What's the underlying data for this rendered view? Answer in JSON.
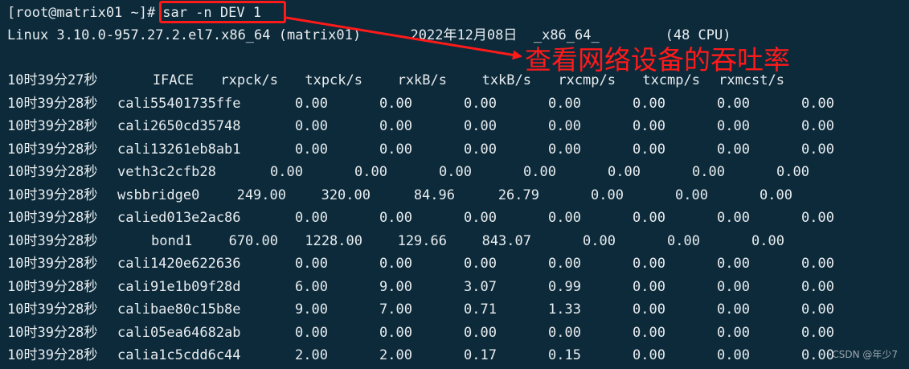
{
  "terminal": {
    "prompt": "[root@matrix01 ~]#",
    "command": "sar -n DEV 1",
    "sysinfo": "Linux 3.10.0-957.27.2.el7.x86_64 (matrix01)      2022年12月08日  _x86_64_        (48 CPU)",
    "header": {
      "time": "10时39分27秒",
      "columns": [
        "IFACE",
        "rxpck/s",
        "txpck/s",
        "rxkB/s",
        "txkB/s",
        "rxcmp/s",
        "txcmp/s",
        "rxmcst/s"
      ]
    },
    "rows": [
      {
        "time": "10时39分28秒",
        "iface": "cali55401735ffe",
        "values": [
          "0.00",
          "0.00",
          "0.00",
          "0.00",
          "0.00",
          "0.00",
          "0.00"
        ]
      },
      {
        "time": "10时39分28秒",
        "iface": "cali2650cd35748",
        "values": [
          "0.00",
          "0.00",
          "0.00",
          "0.00",
          "0.00",
          "0.00",
          "0.00"
        ]
      },
      {
        "time": "10时39分28秒",
        "iface": "cali13261eb8ab1",
        "values": [
          "0.00",
          "0.00",
          "0.00",
          "0.00",
          "0.00",
          "0.00",
          "0.00"
        ]
      },
      {
        "time": "10时39分28秒",
        "iface": "veth3c2cfb28",
        "values": [
          "0.00",
          "0.00",
          "0.00",
          "0.00",
          "0.00",
          "0.00",
          "0.00"
        ]
      },
      {
        "time": "10时39分28秒",
        "iface": "wsbbridge0",
        "values": [
          "249.00",
          "320.00",
          "84.96",
          "26.79",
          "0.00",
          "0.00",
          "0.00"
        ]
      },
      {
        "time": "10时39分28秒",
        "iface": "calied013e2ac86",
        "values": [
          "0.00",
          "0.00",
          "0.00",
          "0.00",
          "0.00",
          "0.00",
          "0.00"
        ]
      },
      {
        "time": "10时39分28秒",
        "iface": "bond1",
        "values": [
          "670.00",
          "1228.00",
          "129.66",
          "843.07",
          "0.00",
          "0.00",
          "0.00"
        ]
      },
      {
        "time": "10时39分28秒",
        "iface": "cali1420e622636",
        "values": [
          "0.00",
          "0.00",
          "0.00",
          "0.00",
          "0.00",
          "0.00",
          "0.00"
        ]
      },
      {
        "time": "10时39分28秒",
        "iface": "cali91e1b09f28d",
        "values": [
          "6.00",
          "9.00",
          "3.07",
          "0.99",
          "0.00",
          "0.00",
          "0.00"
        ]
      },
      {
        "time": "10时39分28秒",
        "iface": "calibae80c15b8e",
        "values": [
          "9.00",
          "7.00",
          "0.71",
          "1.33",
          "0.00",
          "0.00",
          "0.00"
        ]
      },
      {
        "time": "10时39分28秒",
        "iface": "cali05ea64682ab",
        "values": [
          "0.00",
          "0.00",
          "0.00",
          "0.00",
          "0.00",
          "0.00",
          "0.00"
        ]
      },
      {
        "time": "10时39分28秒",
        "iface": "calia1c5cdd6c44",
        "values": [
          "2.00",
          "2.00",
          "0.17",
          "0.15",
          "0.00",
          "0.00",
          "0.00"
        ]
      }
    ]
  },
  "annotation": {
    "text": "查看网络设备的吞吐率",
    "color": "#ff1a1a"
  },
  "watermark": "CSDN @年少7",
  "colors": {
    "background": "#0c2a3a",
    "foreground": "#e8ecef",
    "annotation": "#ff1a1a"
  }
}
